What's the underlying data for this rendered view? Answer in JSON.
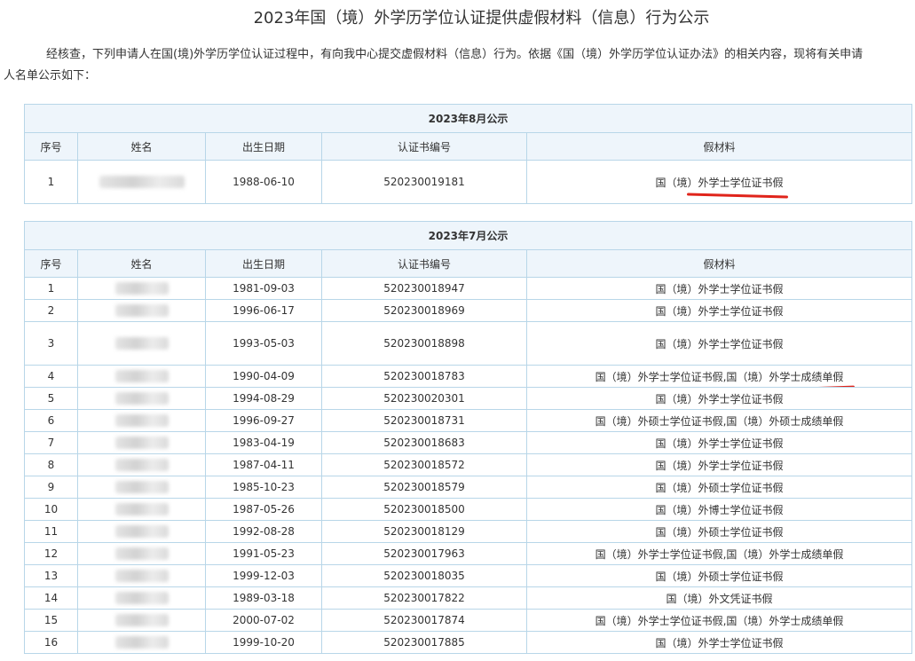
{
  "page": {
    "title": "2023年国（境）外学历学位认证提供虚假材料（信息）行为公示",
    "intro_line1": "经核查，下列申请人在国(境)外学历学位认证过程中，有向我中心提交虚假材料（信息）行为。依据《国（境）外学历学位认证办法》的相关内容，现将有关申请",
    "intro_line2": "人名单公示如下："
  },
  "columns": [
    "序号",
    "姓名",
    "出生日期",
    "认证书编号",
    "假材料"
  ],
  "august": {
    "caption": "2023年8月公示",
    "rows": [
      {
        "no": "1",
        "dob": "1988-06-10",
        "cert": "520230019181",
        "material": "国（境）外学士学位证书假"
      }
    ]
  },
  "july": {
    "caption": "2023年7月公示",
    "rows": [
      {
        "no": "1",
        "dob": "1981-09-03",
        "cert": "520230018947",
        "material": "国（境）外学士学位证书假"
      },
      {
        "no": "2",
        "dob": "1996-06-17",
        "cert": "520230018969",
        "material": "国（境）外学士学位证书假"
      },
      {
        "no": "3",
        "dob": "1993-05-03",
        "cert": "520230018898",
        "material": "国（境）外学士学位证书假"
      },
      {
        "no": "4",
        "dob": "1990-04-09",
        "cert": "520230018783",
        "material": "国（境）外学士学位证书假,国（境）外学士成绩单假"
      },
      {
        "no": "5",
        "dob": "1994-08-29",
        "cert": "520230020301",
        "material": "国（境）外学士学位证书假"
      },
      {
        "no": "6",
        "dob": "1996-09-27",
        "cert": "520230018731",
        "material": "国（境）外硕士学位证书假,国（境）外硕士成绩单假"
      },
      {
        "no": "7",
        "dob": "1983-04-19",
        "cert": "520230018683",
        "material": "国（境）外学士学位证书假"
      },
      {
        "no": "8",
        "dob": "1987-04-11",
        "cert": "520230018572",
        "material": "国（境）外学士学位证书假"
      },
      {
        "no": "9",
        "dob": "1985-10-23",
        "cert": "520230018579",
        "material": "国（境）外硕士学位证书假"
      },
      {
        "no": "10",
        "dob": "1987-05-26",
        "cert": "520230018500",
        "material": "国（境）外博士学位证书假"
      },
      {
        "no": "11",
        "dob": "1992-08-28",
        "cert": "520230018129",
        "material": "国（境）外硕士学位证书假"
      },
      {
        "no": "12",
        "dob": "1991-05-23",
        "cert": "520230017963",
        "material": "国（境）外学士学位证书假,国（境）外学士成绩单假"
      },
      {
        "no": "13",
        "dob": "1999-12-03",
        "cert": "520230018035",
        "material": "国（境）外硕士学位证书假"
      },
      {
        "no": "14",
        "dob": "1989-03-18",
        "cert": "520230017822",
        "material": "国（境）外文凭证书假"
      },
      {
        "no": "15",
        "dob": "2000-07-02",
        "cert": "520230017874",
        "material": "国（境）外学士学位证书假,国（境）外学士成绩单假"
      },
      {
        "no": "16",
        "dob": "1999-10-20",
        "cert": "520230017885",
        "material": "国（境）外学士学位证书假"
      }
    ]
  }
}
